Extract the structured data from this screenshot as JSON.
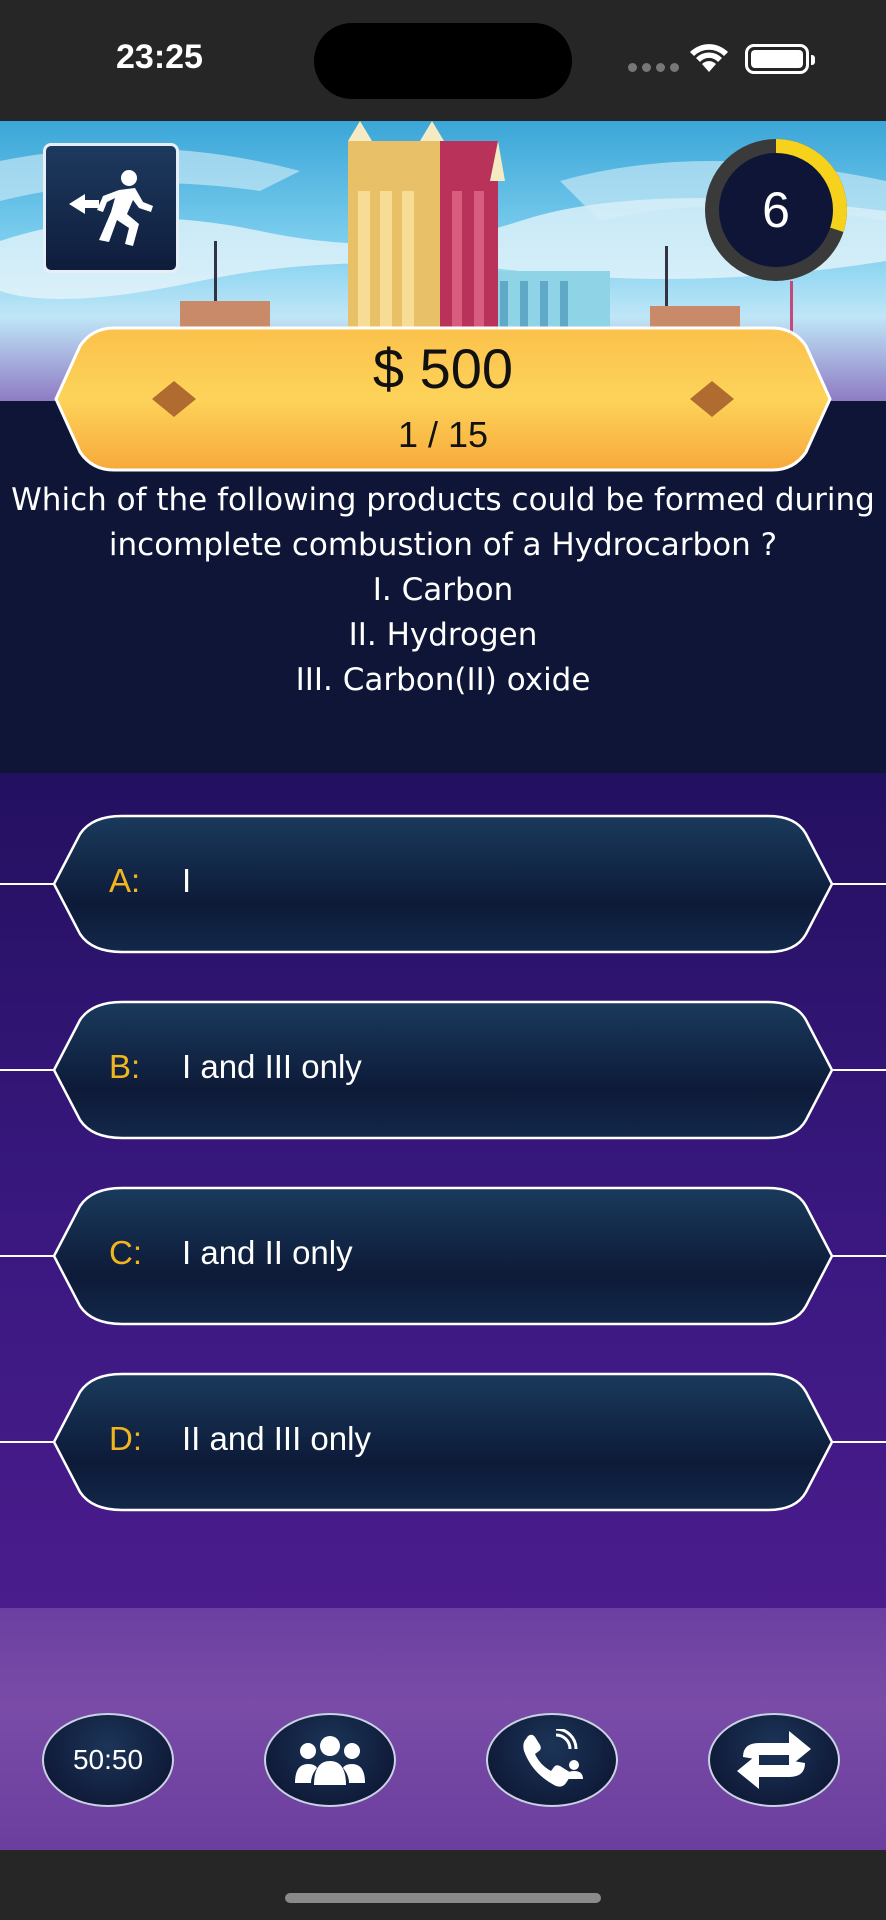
{
  "status_bar": {
    "time": "23:25"
  },
  "game": {
    "timer_value": "6",
    "timer_fraction_elapsed": 0.3,
    "prize_amount": "$ 500",
    "question_counter": "1 / 15"
  },
  "question": {
    "lines": [
      "Which of the following products could be formed during",
      "incomplete combustion of a Hydrocarbon ?",
      "I. Carbon",
      "II. Hydrogen",
      "III. Carbon(II) oxide"
    ]
  },
  "answers": [
    {
      "letter": "A:",
      "text": "I"
    },
    {
      "letter": "B:",
      "text": "I and III only"
    },
    {
      "letter": "C:",
      "text": "I and II only"
    },
    {
      "letter": "D:",
      "text": "II and III only"
    }
  ],
  "lifelines": {
    "fifty_fifty_label": "50:50",
    "ask_audience_icon": "audience-icon",
    "phone_friend_icon": "phone-call-icon",
    "switch_question_icon": "switch-arrows-icon"
  },
  "colors": {
    "letter_accent": "#f3b51e",
    "timer_progress": "#f6d21c",
    "prize_banner": "#fbc345"
  }
}
